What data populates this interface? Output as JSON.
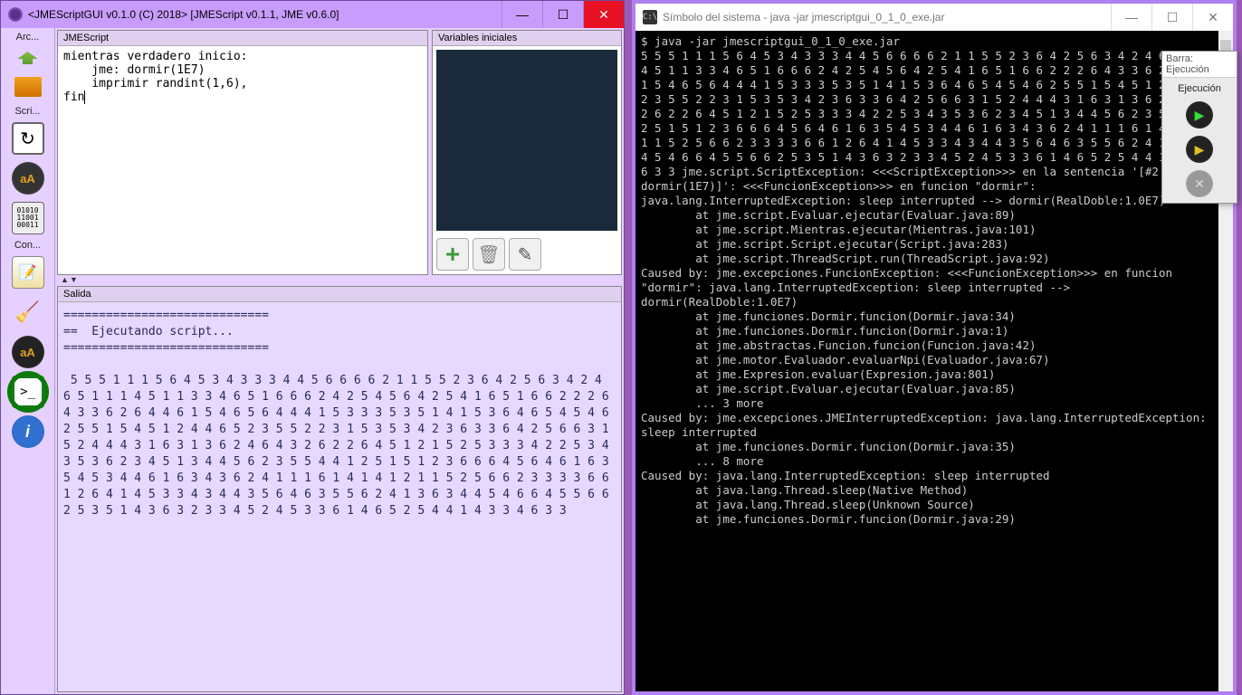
{
  "jme_window": {
    "title": "<JMEScriptGUI v0.1.0 (C) 2018>    [JMEScript v0.1.1, JME v0.6.0]",
    "toolbar": {
      "section1": "Arc...",
      "section2": "Scri...",
      "section3": "Con..."
    },
    "code_panel": {
      "title": "JMEScript",
      "code_line1": "mientras verdadero inicio:",
      "code_line2": "    jme: dormir(1E7)",
      "code_line3": "    imprimir randint(1,6),",
      "code_line4": "fin"
    },
    "vars_panel": {
      "title": "Variables iniciales"
    },
    "output_panel": {
      "title": "Salida",
      "header": "=============================\n==  Ejecutando script...\n=============================",
      "numbers": " 5 5 5 1 1 1 5 6 4 5 3 4 3 3 3 4 4 5 6 6 6 6 2 1 1 5 5 2 3 6 4 2 5 6 3 4 2 4 6 5 1 1 1 4 5 1 1 3 3 4 6 5 1 6 6 6 2 4 2 5 4 5 6 4 2 5 4 1 6 5 1 6 6 2 2 2 6 4 3 3 6 2 6 4 4 6 1 5 4 6 5 6 4 4 4 1 5 3 3 3 5 3 5 1 4 1 5 3 6 4 6 5 4 5 4 6 2 5 5 1 5 4 5 1 2 4 4 6 5 2 3 5 5 2 2 3 1 5 3 5 3 4 2 3 6 3 3 6 4 2 5 6 6 3 1 5 2 4 4 4 3 1 6 3 1 3 6 2 4 6 4 3 2 6 2 2 6 4 5 1 2 1 5 2 5 3 3 3 4 2 2 5 3 4 3 5 3 6 2 3 4 5 1 3 4 4 5 6 2 3 5 5 4 4 1 2 5 1 5 1 2 3 6 6 6 4 5 6 4 6 1 6 3 5 4 5 3 4 4 6 1 6 3 4 3 6 2 4 1 1 1 6 1 4 1 4 1 2 1 1 5 2 5 6 6 2 3 3 3 3 6 6 1 2 6 4 1 4 5 3 3 4 3 4 4 3 5 6 4 6 3 5 5 6 2 4 1 3 6 3 4 4 5 4 6 6 4 5 5 6 6 2 5 3 5 1 4 3 6 3 2 3 3 4 5 2 4 5 3 3 6 1 4 6 5 2 5 4 4 1 4 3 3 4 6 3 3"
    }
  },
  "console_window": {
    "title": "Símbolo del sistema - java  -jar jmescriptgui_0_1_0_exe.jar",
    "prompt": "$ java -jar jmescriptgui_0_1_0_exe.jar",
    "numbers": "5 5 5 1 1 1 5 6 4 5 3 4 3 3 3 4 4 5 6 6 6 6 2 1 1 5 5 2 3 6 4 2 5 6 3 4 2 4 6 5 1 1 1 4 5 1 1 3 3 4 6 5 1 6 6 6 2 4 2 5 4 5 6 4 2 5 4 1 6 5 1 6 6 2 2 2 6 4 3 3 6 2 6 4 4 6 1 5 4 6 5 6 4 4 4 1 5 3 3 3 5 3 5 1 4 1 5 3 6 4 6 5 4 5 4 6 2 5 5 1 5 4 5 1 2 4 4 6 5 2 3 5 5 2 2 3 1 5 3 5 3 4 2 3 6 3 3 6 4 2 5 6 6 3 1 5 2 4 4 4 3 1 6 3 1 3 6 2 4 6 4 3 2 6 2 2 6 4 5 1 2 1 5 2 5 3 3 3 4 2 2 5 3 4 3 5 3 6 2 3 4 5 1 3 4 4 5 6 2 3 5 5 4 4 1 2 5 1 5 1 2 3 6 6 6 4 5 6 4 6 1 6 3 5 4 5 3 4 4 6 1 6 3 4 3 6 2 4 1 1 1 6 1 4 1 4 1 2 1 1 5 2 5 6 6 2 3 3 3 3 6 6 1 2 6 4 1 4 5 3 3 4 3 4 4 3 5 6 4 6 3 5 5 6 2 4 1 3 6 3 4 4 5 4 6 6 4 5 5 6 6 2 5 3 5 1 4 3 6 3 2 3 3 4 5 2 4 5 3 3 6 1 4 6 5 2 5 4 4 1 4 3 3 4 6 3 3 jme.script.ScriptException: <<<ScriptException>>> en la sentencia '[#2: jme: dormir(1E7)]': <<<FuncionException>>> en funcion \"dormir\": java.lang.InterruptedException: sleep interrupted --> dormir(RealDoble:1.0E7)\n        at jme.script.Evaluar.ejecutar(Evaluar.java:89)\n        at jme.script.Mientras.ejecutar(Mientras.java:101)\n        at jme.script.Script.ejecutar(Script.java:283)\n        at jme.script.ThreadScript.run(ThreadScript.java:92)\nCaused by: jme.excepciones.FuncionException: <<<FuncionException>>> en funcion \"dormir\": java.lang.InterruptedException: sleep interrupted --> dormir(RealDoble:1.0E7)\n        at jme.funciones.Dormir.funcion(Dormir.java:34)\n        at jme.funciones.Dormir.funcion(Dormir.java:1)\n        at jme.abstractas.Funcion.funcion(Funcion.java:42)\n        at jme.motor.Evaluador.evaluarNpi(Evaluador.java:67)\n        at jme.Expresion.evaluar(Expresion.java:801)\n        at jme.script.Evaluar.ejecutar(Evaluar.java:85)\n        ... 3 more\nCaused by: jme.excepciones.JMEInterruptedException: java.lang.InterruptedException: sleep interrupted\n        at jme.funciones.Dormir.funcion(Dormir.java:35)\n        ... 8 more\nCaused by: java.lang.InterruptedException: sleep interrupted\n        at java.lang.Thread.sleep(Native Method)\n        at java.lang.Thread.sleep(Unknown Source)\n        at jme.funciones.Dormir.funcion(Dormir.java:29)"
  },
  "float_toolbar": {
    "title": "Barra: Ejecución",
    "label": "Ejecución"
  }
}
